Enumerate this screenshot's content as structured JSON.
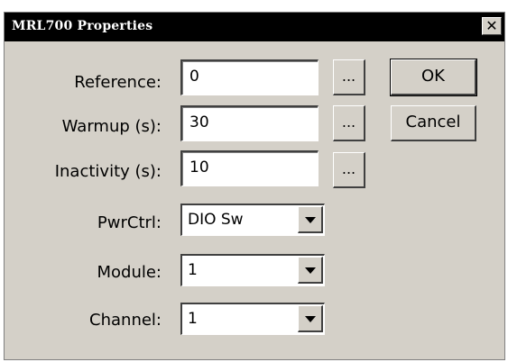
{
  "window": {
    "title": "MRL700 Properties",
    "close_label": "✕"
  },
  "labels": {
    "reference": "Reference:",
    "warmup": "Warmup (s):",
    "inactivity": "Inactivity (s):",
    "pwrctrl": "PwrCtrl:",
    "module": "Module:",
    "channel": "Channel:"
  },
  "fields": {
    "reference": "0",
    "warmup": "30",
    "inactivity": "10"
  },
  "combos": {
    "pwrctrl": "DIO Sw",
    "module": "1",
    "channel": "1"
  },
  "buttons": {
    "browse": "...",
    "ok": "OK",
    "cancel": "Cancel"
  }
}
